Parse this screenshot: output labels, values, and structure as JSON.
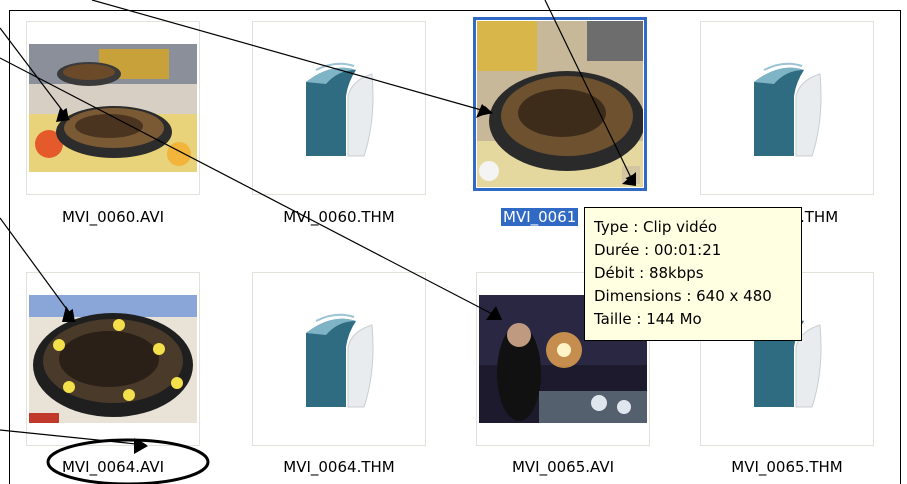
{
  "files": [
    {
      "name": "MVI_0060.AVI",
      "kind": "video",
      "icon": "paella-pan-photo"
    },
    {
      "name": "MVI_0060.THM",
      "kind": "thm",
      "icon": "thm-file-icon"
    },
    {
      "name": "MVI_0061.AVI",
      "kind": "video",
      "icon": "paella-closeup-photo",
      "selected": true,
      "visible_label": "MVI_0061"
    },
    {
      "name": "MVI_0061.THM",
      "kind": "thm",
      "icon": "thm-file-icon",
      "visible_label": ".THM"
    },
    {
      "name": "MVI_0064.AVI",
      "kind": "video",
      "icon": "paella-lemons-photo"
    },
    {
      "name": "MVI_0064.THM",
      "kind": "thm",
      "icon": "thm-file-icon"
    },
    {
      "name": "MVI_0065.AVI",
      "kind": "video",
      "icon": "dinner-room-photo"
    },
    {
      "name": "MVI_0065.THM",
      "kind": "thm",
      "icon": "thm-file-icon"
    }
  ],
  "tooltip": {
    "type": "Type : Clip vidéo",
    "duration": "Durée : 00:01:21",
    "bitrate": "Débit : 88kbps",
    "dimensions": "Dimensions : 640 x 480",
    "size": "Taille  : 144 Mo"
  },
  "colors": {
    "selection": "#316ac5",
    "tooltip_bg": "#ffffe1",
    "thm_icon_teal": "#2f6c82"
  }
}
